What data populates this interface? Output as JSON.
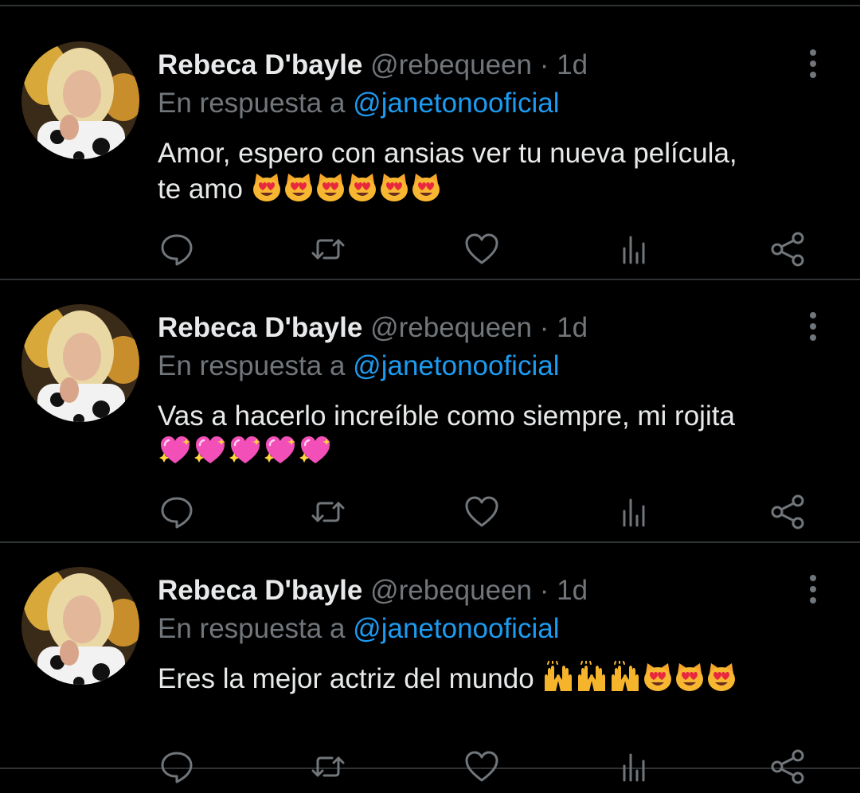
{
  "colors": {
    "background": "#000000",
    "divider": "#2f3336",
    "primary_text": "#e7e9ea",
    "muted_text": "#71767b",
    "mention": "#1d9bf0"
  },
  "icons": {
    "more": "vertical-ellipsis",
    "reply": "speech-bubble",
    "retweet": "retweet-arrows",
    "like": "heart-outline",
    "analytics": "bar-chart",
    "share": "share-nodes"
  },
  "tweets": [
    {
      "author_name": "Rebeca D'bayle",
      "handle": "@rebequeen",
      "separator": "·",
      "time": "1d",
      "reply_prefix": "En respuesta a",
      "reply_to": "@janetonooficial",
      "text_line1": "Amor, espero con ansias ver tu nueva película,",
      "text_line2": "te amo",
      "emojis": [
        "heart-eyes-cat",
        "heart-eyes-cat",
        "heart-eyes-cat",
        "heart-eyes-cat",
        "heart-eyes-cat",
        "heart-eyes-cat"
      ]
    },
    {
      "author_name": "Rebeca D'bayle",
      "handle": "@rebequeen",
      "separator": "·",
      "time": "1d",
      "reply_prefix": "En respuesta a",
      "reply_to": "@janetonooficial",
      "text_line1": "Vas a hacerlo increíble como siempre, mi rojita",
      "text_line2": "",
      "emojis": [
        "sparkling-heart",
        "sparkling-heart",
        "sparkling-heart",
        "sparkling-heart",
        "sparkling-heart"
      ]
    },
    {
      "author_name": "Rebeca D'bayle",
      "handle": "@rebequeen",
      "separator": "·",
      "time": "1d",
      "reply_prefix": "En respuesta a",
      "reply_to": "@janetonooficial",
      "text_line1": "Eres la mejor actriz del mundo",
      "text_line2": "",
      "emojis": [
        "raising-hands",
        "raising-hands",
        "raising-hands",
        "heart-eyes-cat",
        "heart-eyes-cat",
        "heart-eyes-cat"
      ]
    }
  ]
}
